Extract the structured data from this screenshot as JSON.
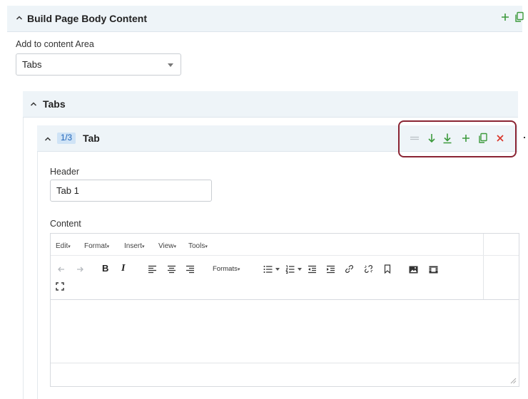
{
  "build_section": {
    "title": "Build Page Body Content",
    "add_area_label": "Add to content Area",
    "area_select_value": "Tabs"
  },
  "tabs_section": {
    "title": "Tabs"
  },
  "tab_item": {
    "counter": "1/3",
    "title": "Tab",
    "header_label": "Header",
    "header_value": "Tab 1",
    "content_label": "Content"
  },
  "editor": {
    "menu": {
      "edit": "Edit",
      "format": "Format",
      "insert": "Insert",
      "view": "View",
      "tools": "Tools"
    },
    "toolbar": {
      "bold": "B",
      "italic": "I",
      "formats": "Formats"
    }
  },
  "icons": {
    "build_toggle": "chevron-up-icon",
    "build_add": "plus-icon",
    "build_copy": "copy-icon",
    "tab_actions": [
      "drag-handle-icon",
      "arrow-down-icon",
      "arrow-to-bottom-icon",
      "plus-icon",
      "copy-icon",
      "close-icon"
    ]
  },
  "colors": {
    "panel_header_bg": "#eef4f8",
    "accent_green": "#3c9a3c",
    "delete_red": "#d9362b",
    "highlight_border": "#8a2433",
    "counter_badge_bg": "#cfe3f6",
    "counter_badge_text": "#1d63b8"
  }
}
